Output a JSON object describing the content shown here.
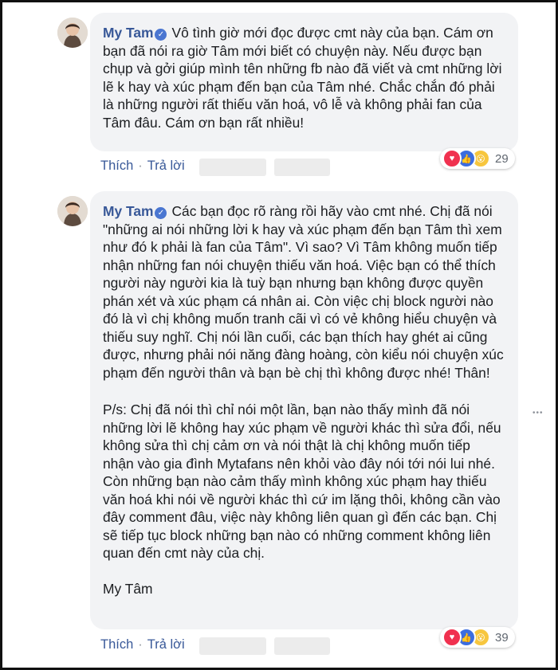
{
  "comments": [
    {
      "author": "My Tam",
      "paragraphs": [
        "Vô tình giờ mới đọc được cmt này của bạn. Cám ơn bạn đã nói ra giờ Tâm mới biết có chuyện này. Nếu được bạn chụp và gởi giúp mình tên những fb nào đã viết và cmt những lời lẽ k hay và xúc phạm đến bạn của Tâm nhé. Chắc chắn đó phải là những người rất thiếu văn hoá, vô lễ và không phải fan của Tâm đâu. Cám ơn bạn rất nhiều!"
      ],
      "actions": {
        "like": "Thích",
        "separator": "·",
        "reply": "Trả lời"
      },
      "reaction_count": "29"
    },
    {
      "author": "My Tam",
      "paragraphs": [
        "Các bạn đọc rõ ràng rồi hãy vào cmt nhé. Chị đã nói \"những ai nói những lời k hay và xúc phạm đến bạn Tâm thì xem như đó k phải là fan của Tâm\". Vì sao? Vì Tâm không muốn tiếp nhận những fan nói chuyện thiếu văn hoá. Việc bạn có thể thích người này người kia là tuỳ bạn nhưng bạn không được quyền phán xét và xúc phạm cá nhân ai. Còn việc chị block người nào đó là vì chị không muốn tranh cãi vì có vẻ không hiểu chuyện và thiếu suy nghĩ. Chị nói lần cuối, các bạn thích hay ghét ai cũng được, nhưng phải nói năng đàng hoàng, còn kiểu nói chuyện xúc phạm đến người thân và bạn bè chị thì không được nhé! Thân!",
        "P/s: Chị đã nói thì chỉ nói một lần, bạn nào thấy mình đã nói những lời lẽ không hay xúc phạm về người khác thì sửa đổi, nếu không sửa thì chị cảm ơn và nói thật là chị không muốn tiếp nhận vào gia đình Mytafans nên khỏi vào đây nói tới nói lui nhé. Còn những bạn nào cảm thấy mình không xúc phạm hay thiếu văn hoá khi nói về người khác thì cứ im lặng thôi, không cần vào đây comment đâu, việc này không liên quan gì đến các bạn. Chị sẽ tiếp tục block những bạn nào có những comment không liên quan đến cmt này của chị.",
        "My Tâm"
      ],
      "actions": {
        "like": "Thích",
        "separator": "·",
        "reply": "Trả lời"
      },
      "reaction_count": "39"
    }
  ],
  "icons": {
    "verified": "verified-badge-icon",
    "reactions": [
      "love-reaction-icon",
      "like-reaction-icon",
      "wow-reaction-icon"
    ],
    "more": "more-options-icon"
  },
  "colors": {
    "author": "#385898",
    "bubble": "#f2f3f5",
    "link": "#385898",
    "verified": "#4a76d1"
  }
}
